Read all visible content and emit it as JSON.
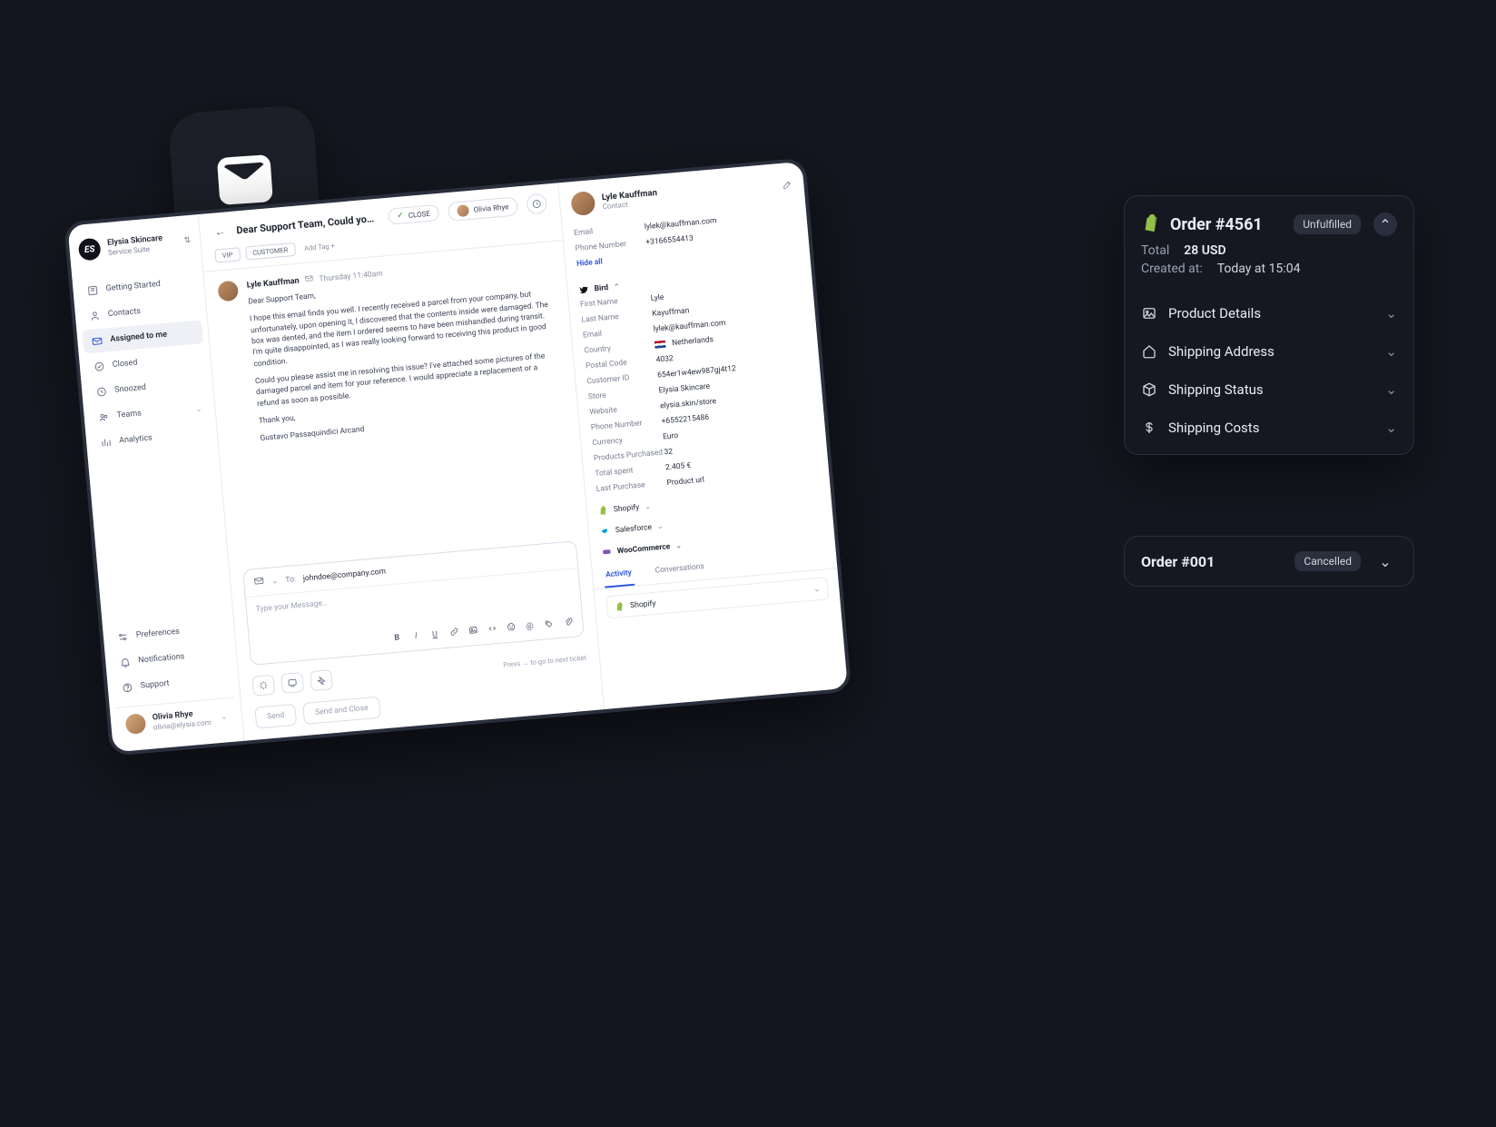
{
  "brand": {
    "title": "Elysia Skincare",
    "sub": "Service Suite",
    "logo_text": "ES"
  },
  "sidebar": {
    "items": [
      {
        "label": "Getting Started"
      },
      {
        "label": "Contacts"
      },
      {
        "label": "Assigned to me"
      },
      {
        "label": "Closed"
      },
      {
        "label": "Snoozed"
      },
      {
        "label": "Teams"
      },
      {
        "label": "Analytics"
      }
    ],
    "footer": [
      {
        "label": "Preferences"
      },
      {
        "label": "Notifications"
      },
      {
        "label": "Support"
      }
    ]
  },
  "current_user": {
    "name": "Olivia Rhye",
    "email": "olivia@elysia.com"
  },
  "thread": {
    "subject": "Dear Support Team, Could you please assist m…",
    "close_label": "CLOSE",
    "assignee": "Olivia Rhye",
    "tags": [
      "VIP",
      "CUSTOMER"
    ],
    "add_tag": "Add Tag +",
    "message": {
      "from": "Lyle Kauffman",
      "at_label": "Thursday 11:40am",
      "greeting": "Dear Support Team,",
      "p1": "I hope this email finds you well. I recently received a parcel from your company, but unfortunately, upon opening it, I discovered that the contents inside were damaged. The box was dented, and the item I ordered seems to have been mishandled during transit. I'm quite disappointed, as I was really looking forward to receiving this product in good condition.",
      "p2": "Could you please assist me in resolving this issue? I've attached some pictures of the damaged parcel and item for your reference. I would appreciate a replacement or a refund as soon as possible.",
      "thanks": "Thank you,",
      "sig": "Gustavo Passaquindici Arcand"
    },
    "composer": {
      "to_label": "To:",
      "to_value": "johndoe@company.com",
      "placeholder": "Type your Message…",
      "hint": "Press → to go to next ticket",
      "send": "Send",
      "send_close": "Send and Close"
    }
  },
  "contact": {
    "name": "Lyle Kauffman",
    "sub": "Contact",
    "top_kv": [
      {
        "k": "Email",
        "v": "lylek@kauffman.com"
      },
      {
        "k": "Phone Number",
        "v": "+3166554413"
      }
    ],
    "hide_all": "Hide all",
    "integration_name": "Bird",
    "kv": [
      {
        "k": "First Name",
        "v": "Lyle"
      },
      {
        "k": "Last Name",
        "v": "Kayuffman"
      },
      {
        "k": "Email",
        "v": "lylek@kauffman.com"
      },
      {
        "k": "Country",
        "v": "Netherlands",
        "flag": true
      },
      {
        "k": "Postal Code",
        "v": "4032"
      },
      {
        "k": "Customer ID",
        "v": "654er1w4ew987gj4t12"
      },
      {
        "k": "Store",
        "v": "Elysia Skincare"
      },
      {
        "k": "Website",
        "v": "elysia.skin/store"
      },
      {
        "k": "Phone Number",
        "v": "+6552215486"
      },
      {
        "k": "Currency",
        "v": "Euro"
      },
      {
        "k": "Products Purchased",
        "v": "32"
      },
      {
        "k": "Total spent",
        "v": "2.405 €"
      },
      {
        "k": "Last Purchase",
        "v": "Product url"
      }
    ],
    "integrations": [
      "Shopify",
      "Salesforce",
      "WooCommerce"
    ],
    "tab_activity": "Activity",
    "tab_conversations": "Conversations",
    "activity_item": "Shopify"
  },
  "order_panel": {
    "title": "Order #4561",
    "badge": "Unfulfilled",
    "total_label": "Total",
    "total_value": "28 USD",
    "created_label": "Created at:",
    "created_value": "Today at 15:04",
    "sections": [
      "Product Details",
      "Shipping Address",
      "Shipping Status",
      "Shipping Costs"
    ]
  },
  "order_panel2": {
    "title": "Order #001",
    "badge": "Cancelled"
  }
}
